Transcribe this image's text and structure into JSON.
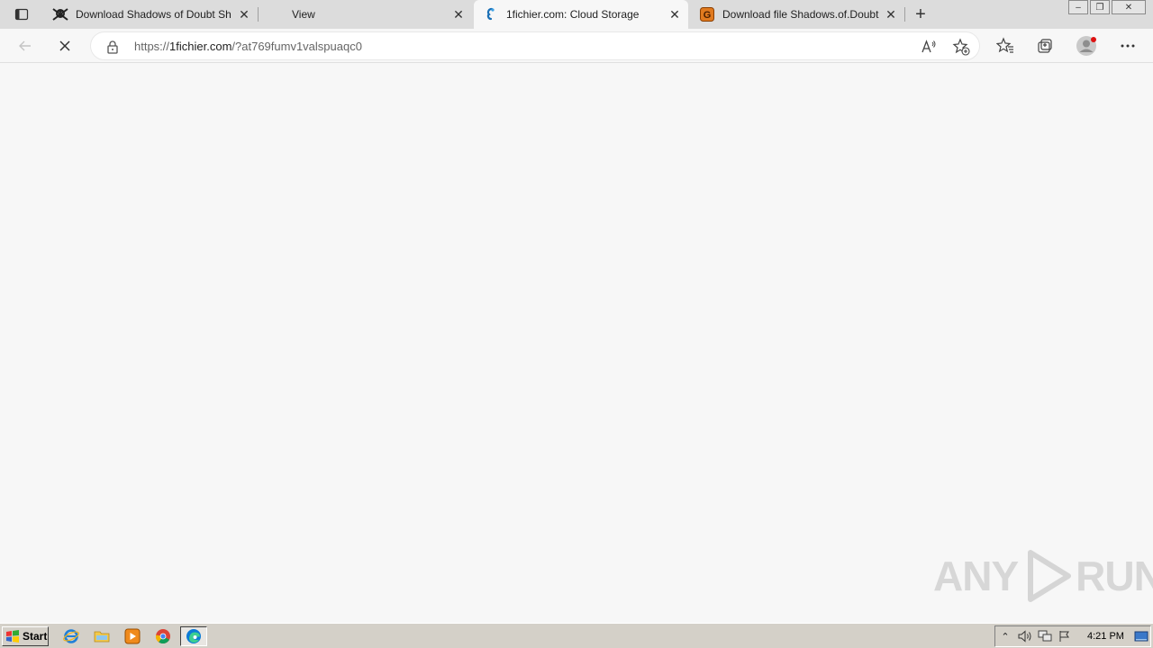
{
  "browser": {
    "tabs": [
      {
        "title": "Download Shadows of Doubt Sh",
        "icon": "skull-icon",
        "active": false
      },
      {
        "title": "View",
        "icon": "none",
        "active": false
      },
      {
        "title": "1fichier.com: Cloud Storage",
        "icon": "1fichier-icon",
        "active": true
      },
      {
        "title": "Download file Shadows.of.Doubt",
        "icon": "orange-site-icon",
        "active": false
      }
    ],
    "new_tab": "+",
    "address": {
      "scheme": "https://",
      "host": "1fichier.com",
      "path": "/?at769fumv1valspuaqc0"
    },
    "read_aloud": "A⁵"
  },
  "watermark": {
    "left": "ANY",
    "right": "RUN"
  },
  "taskbar": {
    "start_label": "Start",
    "clock": "4:21 PM"
  },
  "colors": {
    "accent": "#0078d4",
    "taskbar": "#d4d0c8",
    "background": "#f7f7f7"
  }
}
